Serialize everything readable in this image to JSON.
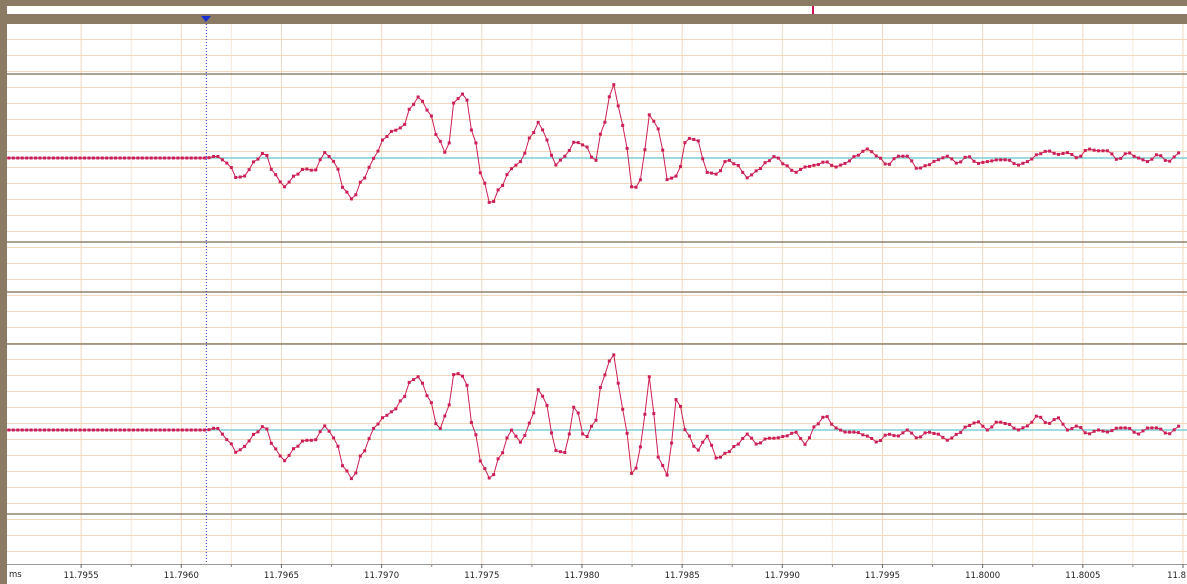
{
  "colors": {
    "frame": "#8b7a64",
    "background": "#ffffff",
    "grid": "#f2d8bd",
    "channel_border": "#7a6a55",
    "baseline": "#7fcfd4",
    "signal": "#cc1f55",
    "cursor": "#1a2fd0",
    "marker": "#d01050"
  },
  "axis": {
    "unit": "ms",
    "tick_labels": [
      "11.7955",
      "11.7960",
      "11.7965",
      "11.7970",
      "11.7975",
      "11.7980",
      "11.7985",
      "11.7990",
      "11.7995",
      "11.8000",
      "11.8005",
      "11.8"
    ]
  },
  "chart_data": {
    "type": "line",
    "xlabel": "ms",
    "xlim": [
      11.79513,
      11.80102
    ],
    "x_ticks": [
      11.7955,
      11.796,
      11.7965,
      11.797,
      11.7975,
      11.798,
      11.7985,
      11.799,
      11.7995,
      11.8,
      11.8005,
      11.801
    ],
    "cursor_x": 11.79616,
    "marker_x": 11.79909,
    "grid": true,
    "series": [
      {
        "values": [
          [
            11.79513,
            0
          ],
          [
            11.79616,
            0
          ],
          [
            11.79621,
            0.05
          ],
          [
            11.79627,
            -0.15
          ],
          [
            11.79631,
            -0.55
          ],
          [
            11.79635,
            -0.5
          ],
          [
            11.7964,
            -0.1
          ],
          [
            11.79645,
            0.15
          ],
          [
            11.7965,
            -0.45
          ],
          [
            11.79655,
            -0.8
          ],
          [
            11.7966,
            -0.5
          ],
          [
            11.79665,
            -0.3
          ],
          [
            11.7967,
            -0.35
          ],
          [
            11.79675,
            0.15
          ],
          [
            11.7968,
            -0.1
          ],
          [
            11.79685,
            -0.9
          ],
          [
            11.79689,
            -1.15
          ],
          [
            11.79694,
            -0.6
          ],
          [
            11.797,
            0
          ],
          [
            11.79704,
            0.5
          ],
          [
            11.79709,
            0.75
          ],
          [
            11.79714,
            0.85
          ],
          [
            11.79718,
            1.4
          ],
          [
            11.79722,
            1.7
          ],
          [
            11.79727,
            1.3
          ],
          [
            11.79732,
            0.5
          ],
          [
            11.79736,
            0.1
          ],
          [
            11.7974,
            1.6
          ],
          [
            11.79745,
            1.8
          ],
          [
            11.79749,
            0.7
          ],
          [
            11.79754,
            -0.6
          ],
          [
            11.79758,
            -1.3
          ],
          [
            11.79763,
            -0.8
          ],
          [
            11.79768,
            -0.3
          ],
          [
            11.79773,
            -0.1
          ],
          [
            11.79778,
            0.6
          ],
          [
            11.79782,
            1.0
          ],
          [
            11.79786,
            0.5
          ],
          [
            11.7979,
            -0.2
          ],
          [
            11.79795,
            0.05
          ],
          [
            11.798,
            0.45
          ],
          [
            11.79805,
            0.35
          ],
          [
            11.7981,
            -0.1
          ],
          [
            11.79814,
            0.9
          ],
          [
            11.79819,
            2.05
          ],
          [
            11.79824,
            0.9
          ],
          [
            11.79829,
            -0.9
          ],
          [
            11.79833,
            -0.6
          ],
          [
            11.79837,
            1.2
          ],
          [
            11.79842,
            0.8
          ],
          [
            11.79846,
            -0.6
          ],
          [
            11.79851,
            -0.5
          ],
          [
            11.79856,
            0.55
          ],
          [
            11.79861,
            0.5
          ],
          [
            11.79866,
            -0.4
          ],
          [
            11.79871,
            -0.45
          ],
          [
            11.79876,
            -0.05
          ],
          [
            11.79881,
            -0.2
          ],
          [
            11.79886,
            -0.55
          ],
          [
            11.79891,
            -0.35
          ],
          [
            11.79896,
            -0.1
          ],
          [
            11.799,
            0.05
          ],
          [
            11.79905,
            -0.2
          ],
          [
            11.7991,
            -0.4
          ],
          [
            11.79915,
            -0.25
          ],
          [
            11.7992,
            -0.2
          ],
          [
            11.79925,
            -0.1
          ],
          [
            11.7993,
            -0.25
          ],
          [
            11.79935,
            -0.15
          ],
          [
            11.7994,
            0.05
          ],
          [
            11.79946,
            0.25
          ],
          [
            11.79951,
            0.05
          ],
          [
            11.79956,
            -0.2
          ],
          [
            11.79961,
            0.05
          ],
          [
            11.79966,
            0.05
          ],
          [
            11.79971,
            -0.3
          ],
          [
            11.79976,
            -0.2
          ],
          [
            11.79981,
            -0.05
          ],
          [
            11.79986,
            0.05
          ],
          [
            11.79991,
            -0.15
          ],
          [
            11.79996,
            0.05
          ],
          [
            11.80001,
            -0.15
          ],
          [
            11.80006,
            -0.1
          ],
          [
            11.80011,
            -0.05
          ],
          [
            11.80016,
            -0.05
          ],
          [
            11.80021,
            -0.2
          ],
          [
            11.80026,
            -0.1
          ],
          [
            11.80031,
            0.1
          ],
          [
            11.80036,
            0.2
          ],
          [
            11.80041,
            0.1
          ],
          [
            11.80046,
            0.15
          ],
          [
            11.80051,
            0
          ],
          [
            11.80056,
            0.25
          ],
          [
            11.80061,
            0.2
          ],
          [
            11.80066,
            0.2
          ],
          [
            11.80071,
            -0.05
          ],
          [
            11.80076,
            0.15
          ],
          [
            11.80081,
            0
          ],
          [
            11.80086,
            -0.1
          ],
          [
            11.80091,
            0.1
          ],
          [
            11.80096,
            -0.1
          ],
          [
            11.80102,
            0.15
          ]
        ]
      },
      {
        "values": [
          [
            11.79513,
            0
          ],
          [
            11.79616,
            0
          ],
          [
            11.79621,
            0.05
          ],
          [
            11.79627,
            -0.25
          ],
          [
            11.79631,
            -0.55
          ],
          [
            11.79635,
            -0.4
          ],
          [
            11.7964,
            -0.1
          ],
          [
            11.79645,
            0.1
          ],
          [
            11.7965,
            -0.45
          ],
          [
            11.79655,
            -0.75
          ],
          [
            11.7966,
            -0.45
          ],
          [
            11.79665,
            -0.25
          ],
          [
            11.7967,
            -0.25
          ],
          [
            11.79675,
            0.1
          ],
          [
            11.7968,
            -0.2
          ],
          [
            11.79685,
            -0.95
          ],
          [
            11.79689,
            -1.2
          ],
          [
            11.79694,
            -0.55
          ],
          [
            11.797,
            0.05
          ],
          [
            11.79704,
            0.3
          ],
          [
            11.79709,
            0.45
          ],
          [
            11.79714,
            0.75
          ],
          [
            11.79718,
            1.2
          ],
          [
            11.79722,
            1.3
          ],
          [
            11.79727,
            0.8
          ],
          [
            11.79732,
            0
          ],
          [
            11.79736,
            0.4
          ],
          [
            11.7974,
            1.4
          ],
          [
            11.79745,
            1.3
          ],
          [
            11.79749,
            0.1
          ],
          [
            11.79754,
            -0.9
          ],
          [
            11.79758,
            -1.2
          ],
          [
            11.79763,
            -0.6
          ],
          [
            11.79768,
            0
          ],
          [
            11.79773,
            -0.3
          ],
          [
            11.79778,
            0.2
          ],
          [
            11.79782,
            1.0
          ],
          [
            11.79786,
            0.6
          ],
          [
            11.7979,
            -0.5
          ],
          [
            11.79795,
            -0.55
          ],
          [
            11.798,
            0.6
          ],
          [
            11.79805,
            -0.2
          ],
          [
            11.7981,
            0.2
          ],
          [
            11.79814,
            1.3
          ],
          [
            11.79819,
            1.85
          ],
          [
            11.79824,
            0.5
          ],
          [
            11.79829,
            -1.15
          ],
          [
            11.79833,
            -0.4
          ],
          [
            11.79837,
            1.3
          ],
          [
            11.79842,
            -0.7
          ],
          [
            11.79846,
            -1.1
          ],
          [
            11.79851,
            0.8
          ],
          [
            11.79856,
            -0.1
          ],
          [
            11.79861,
            -0.5
          ],
          [
            11.79866,
            -0.15
          ],
          [
            11.79871,
            -0.7
          ],
          [
            11.79876,
            -0.55
          ],
          [
            11.79881,
            -0.35
          ],
          [
            11.79886,
            -0.1
          ],
          [
            11.79891,
            -0.35
          ],
          [
            11.79896,
            -0.2
          ],
          [
            11.799,
            -0.2
          ],
          [
            11.79905,
            -0.15
          ],
          [
            11.7991,
            -0.05
          ],
          [
            11.79915,
            -0.35
          ],
          [
            11.7992,
            0.1
          ],
          [
            11.79925,
            0.35
          ],
          [
            11.7993,
            0.05
          ],
          [
            11.79935,
            -0.05
          ],
          [
            11.7994,
            -0.05
          ],
          [
            11.79946,
            -0.15
          ],
          [
            11.79951,
            -0.3
          ],
          [
            11.79956,
            -0.1
          ],
          [
            11.79961,
            -0.15
          ],
          [
            11.79966,
            0
          ],
          [
            11.79971,
            -0.2
          ],
          [
            11.79976,
            -0.05
          ],
          [
            11.79981,
            -0.1
          ],
          [
            11.79986,
            -0.25
          ],
          [
            11.79991,
            -0.1
          ],
          [
            11.79996,
            0.1
          ],
          [
            11.80001,
            0.2
          ],
          [
            11.80006,
            0
          ],
          [
            11.80011,
            0.2
          ],
          [
            11.80016,
            0.15
          ],
          [
            11.80021,
            0
          ],
          [
            11.80026,
            0.1
          ],
          [
            11.80031,
            0.35
          ],
          [
            11.80036,
            0.15
          ],
          [
            11.80041,
            0.3
          ],
          [
            11.80046,
            0
          ],
          [
            11.80051,
            0.1
          ],
          [
            11.80056,
            -0.1
          ],
          [
            11.80061,
            0
          ],
          [
            11.80066,
            -0.05
          ],
          [
            11.80071,
            0.05
          ],
          [
            11.80076,
            0.05
          ],
          [
            11.80081,
            -0.1
          ],
          [
            11.80086,
            0.05
          ],
          [
            11.80091,
            0.05
          ],
          [
            11.80096,
            -0.1
          ],
          [
            11.80102,
            0.1
          ]
        ]
      }
    ]
  }
}
